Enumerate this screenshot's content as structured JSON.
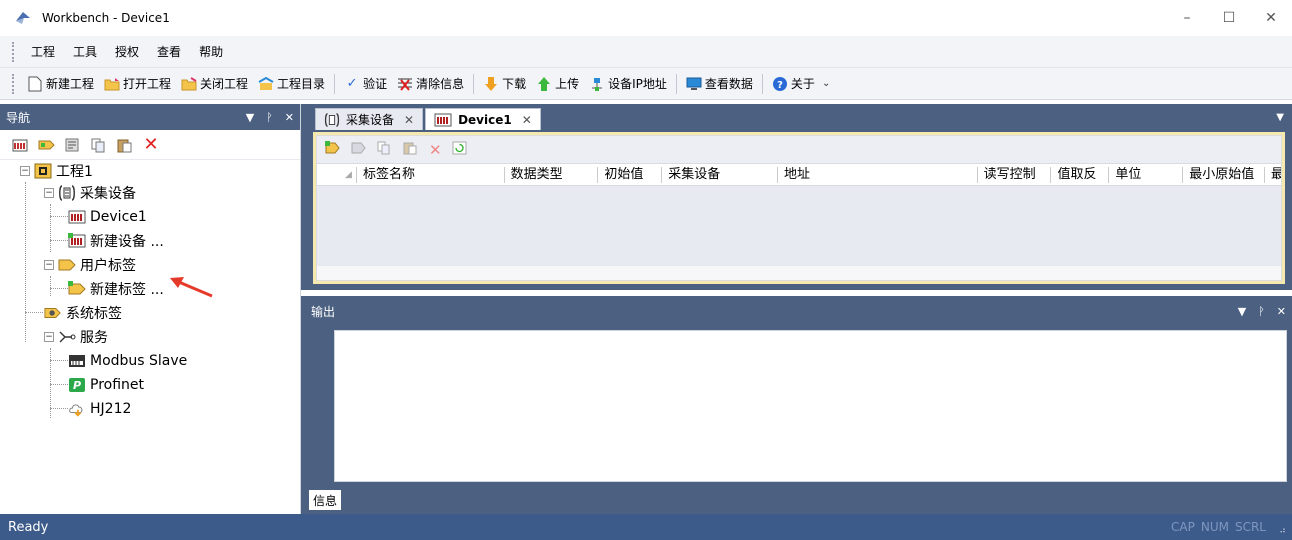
{
  "window": {
    "title": "Workbench - Device1"
  },
  "window_controls": {
    "minimize": "–",
    "maximize": "☐",
    "close": "✕"
  },
  "menu": [
    "工程",
    "工具",
    "授权",
    "查看",
    "帮助"
  ],
  "toolbar": {
    "new_project": "新建工程",
    "open_project": "打开工程",
    "close_project": "关闭工程",
    "project_dir": "工程目录",
    "verify": "验证",
    "clear_info": "清除信息",
    "download": "下载",
    "upload": "上传",
    "device_ip": "设备IP地址",
    "view_data": "查看数据",
    "about": "关于"
  },
  "nav": {
    "title": "导航",
    "tree": {
      "root": "工程1",
      "collect": "采集设备",
      "device1": "Device1",
      "new_device": "新建设备 ...",
      "user_tags": "用户标签",
      "new_tag": "新建标签 ...",
      "system_tags": "系统标签",
      "services": "服务",
      "modbus": "Modbus Slave",
      "profinet": "Profinet",
      "hj212": "HJ212"
    }
  },
  "tabs": [
    {
      "label": "采集设备",
      "active": false
    },
    {
      "label": "Device1",
      "active": true
    }
  ],
  "grid": {
    "columns": [
      "标签名称",
      "数据类型",
      "初始值",
      "采集设备",
      "地址",
      "读写控制",
      "值取反",
      "单位",
      "最小原始值",
      "最"
    ]
  },
  "output": {
    "title": "输出",
    "tab": "信息"
  },
  "status": {
    "text": "Ready",
    "cap": "CAP",
    "num": "NUM",
    "scrl": "SCRL"
  },
  "colors": {
    "panel_header": "#4c6182",
    "status_bar": "#3c5a8a",
    "grid_border": "#f5e9b0"
  }
}
